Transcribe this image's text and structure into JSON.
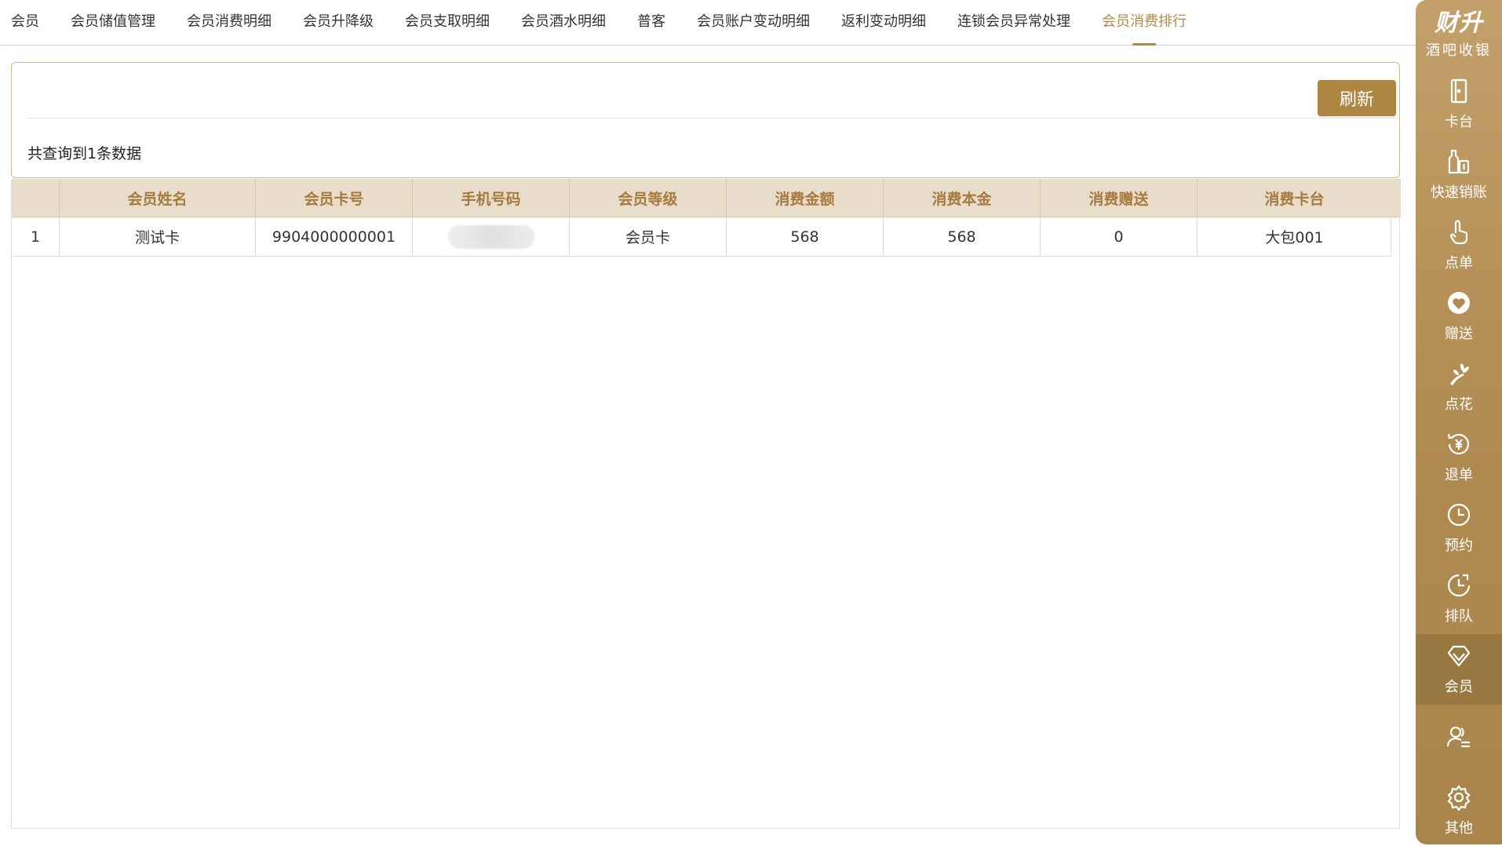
{
  "tabs": [
    {
      "label": "会员",
      "active": false
    },
    {
      "label": "会员储值管理",
      "active": false
    },
    {
      "label": "会员消费明细",
      "active": false
    },
    {
      "label": "会员升降级",
      "active": false
    },
    {
      "label": "会员支取明细",
      "active": false
    },
    {
      "label": "会员酒水明细",
      "active": false
    },
    {
      "label": "普客",
      "active": false
    },
    {
      "label": "会员账户变动明细",
      "active": false
    },
    {
      "label": "返利变动明细",
      "active": false
    },
    {
      "label": "连锁会员异常处理",
      "active": false
    },
    {
      "label": "会员消费排行",
      "active": true
    }
  ],
  "panel": {
    "refresh_label": "刷新",
    "result_count": "共查询到1条数据"
  },
  "table": {
    "columns": [
      "",
      "会员姓名",
      "会员卡号",
      "手机号码",
      "会员等级",
      "消费金额",
      "消费本金",
      "消费赠送",
      "消费卡台"
    ],
    "rows": [
      {
        "index": "1",
        "name": "测试卡",
        "card_no": "9904000000001",
        "phone": "",
        "level": "会员卡",
        "amount": "568",
        "principal": "568",
        "gift": "0",
        "table": "大包001"
      }
    ]
  },
  "sidebar": {
    "brand_name": "财升",
    "brand_sub": "酒吧收银",
    "items": [
      {
        "label": "卡台",
        "icon": "door-icon",
        "active": false
      },
      {
        "label": "快速销账",
        "icon": "bottles-icon",
        "active": false
      },
      {
        "label": "点单",
        "icon": "hand-tap-icon",
        "active": false
      },
      {
        "label": "赠送",
        "icon": "gift-heart-icon",
        "active": false
      },
      {
        "label": "点花",
        "icon": "flower-icon",
        "active": false
      },
      {
        "label": "退单",
        "icon": "refund-yen-icon",
        "active": false
      },
      {
        "label": "预约",
        "icon": "clock-icon",
        "active": false
      },
      {
        "label": "排队",
        "icon": "queue-clock-icon",
        "active": false
      },
      {
        "label": "会员",
        "icon": "diamond-icon",
        "active": true
      },
      {
        "label": "",
        "icon": "users-icon",
        "active": false
      },
      {
        "label": "其他",
        "icon": "gear-icon",
        "active": false
      }
    ]
  },
  "colors": {
    "accent": "#b08a4a",
    "sidebar": "#b08b52",
    "header_bg": "#e8dccb"
  }
}
